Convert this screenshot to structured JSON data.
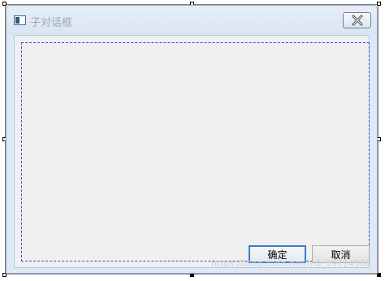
{
  "window": {
    "title": "子对话框"
  },
  "buttons": {
    "ok_label": "确定",
    "cancel_label": "取消"
  },
  "watermark": {
    "text": "https://blog.csdn.net/m0_59714566"
  },
  "icons": {
    "app": "dialog-app-icon",
    "close": "close-icon"
  },
  "colors": {
    "titlebar": "#dfe9f5",
    "client": "#f0f0f0",
    "focus_border": "#3a7cc4",
    "dashed_guide": "#3b4fd0"
  }
}
